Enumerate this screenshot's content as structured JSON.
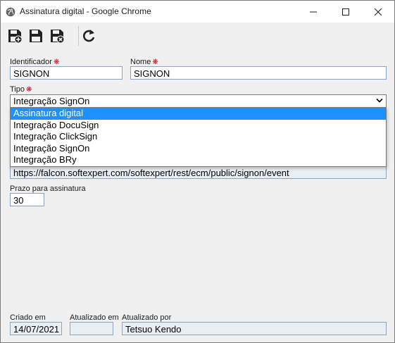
{
  "window": {
    "title": "Assinatura digital - Google Chrome"
  },
  "toolbar": {
    "buttons": [
      {
        "name": "save-new-button",
        "icon": "save-plus-icon"
      },
      {
        "name": "save-button",
        "icon": "save-icon"
      },
      {
        "name": "save-close-button",
        "icon": "save-close-icon"
      },
      {
        "name": "refresh-button",
        "icon": "refresh-icon"
      }
    ]
  },
  "form": {
    "identificador": {
      "label": "Identificador",
      "value": "SIGNON"
    },
    "nome": {
      "label": "Nome",
      "value": "SIGNON"
    },
    "tipo": {
      "label": "Tipo",
      "value": "Integração SignOn",
      "options": [
        "Assinatura digital",
        "Integração DocuSign",
        "Integração ClickSign",
        "Integração SignOn",
        "Integração BRy"
      ],
      "highlighted": "Assinatura digital"
    },
    "url": {
      "value": "https://falcon.softexpert.com/softexpert/rest/ecm/public/signon/event"
    },
    "prazo": {
      "label": "Prazo para assinatura",
      "value": "30"
    },
    "criado_em": {
      "label": "Criado em",
      "value": "14/07/2021"
    },
    "atualizado_em": {
      "label": "Atualizado em",
      "value": ""
    },
    "atualizado_por": {
      "label": "Atualizado por",
      "value": "Tetsuo Kendo"
    }
  },
  "colors": {
    "required": "#d6001c",
    "highlight": "#1e90ff",
    "input_border": "#8aa4bf"
  }
}
